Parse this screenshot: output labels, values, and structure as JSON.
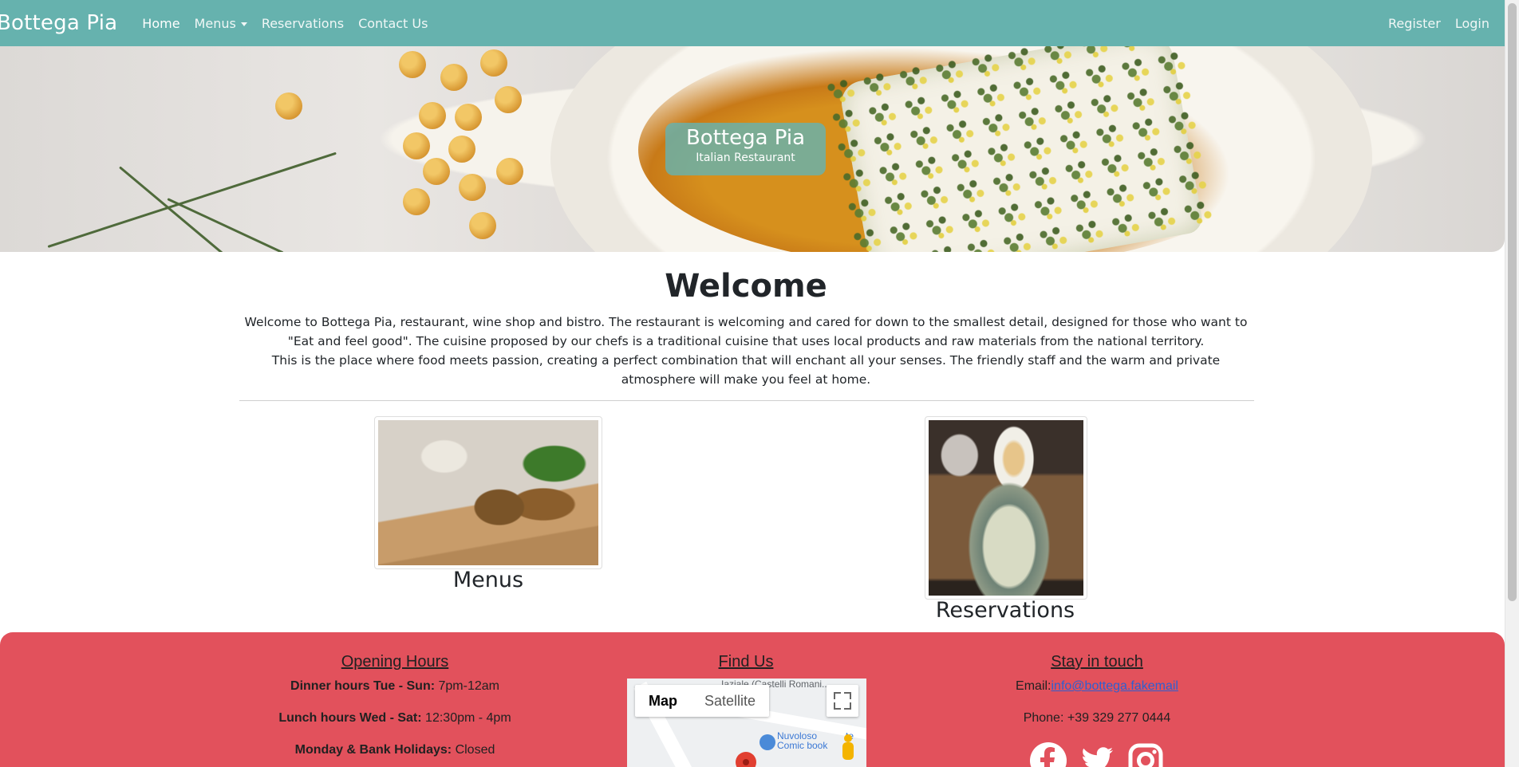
{
  "navbar": {
    "brand": "Bottega Pia",
    "links": [
      {
        "label": "Home"
      },
      {
        "label": "Menus"
      },
      {
        "label": "Reservations"
      },
      {
        "label": "Contact Us"
      }
    ],
    "right_links": [
      {
        "label": "Register"
      },
      {
        "label": "Login"
      }
    ]
  },
  "hero": {
    "title": "Bottega Pia",
    "subtitle": "Italian Restaurant"
  },
  "welcome": {
    "title": "Welcome",
    "paragraph1": "Welcome to Bottega Pia, restaurant, wine shop and bistro. The restaurant is welcoming and cared for down to the smallest detail, designed for those who want to \"Eat and feel good\". The cuisine proposed by our chefs is a traditional cuisine that uses local products and raw materials from the national territory.",
    "paragraph2": "This is the place where food meets passion, creating a perfect combination that will enchant all your senses. The friendly staff and the warm and private atmosphere will make you feel at home."
  },
  "cards": {
    "menus_label": "Menus",
    "reservations_label": "Reservations"
  },
  "footer": {
    "hours": {
      "title": "Opening Hours",
      "lines": [
        {
          "label": "Dinner hours Tue - Sun:",
          "value": "7pm-12am"
        },
        {
          "label": "Lunch hours Wed - Sat:",
          "value": "12:30pm - 4pm"
        },
        {
          "label": "Monday & Bank Holidays:",
          "value": "Closed"
        }
      ]
    },
    "find_us": {
      "title": "Find Us",
      "map": {
        "top_text": "Iaziale (Castelli Romani...",
        "map_button": "Map",
        "satellite_button": "Satellite",
        "poi_name_line1": "Nuvoloso",
        "poi_name_line2": "Comic book",
        "poi_suffix": "te"
      }
    },
    "contact": {
      "title": "Stay in touch",
      "email_label": "Email:",
      "email": "info@bottega.fakemail",
      "phone": "Phone: +39 329 277 0444"
    }
  },
  "colors": {
    "navbar": "#66b2ae",
    "footer": "#e2515c",
    "link": "#2e5fd0"
  },
  "icons": [
    "facebook-icon",
    "twitter-icon",
    "instagram-icon",
    "fullscreen-icon",
    "caret-down-icon"
  ]
}
